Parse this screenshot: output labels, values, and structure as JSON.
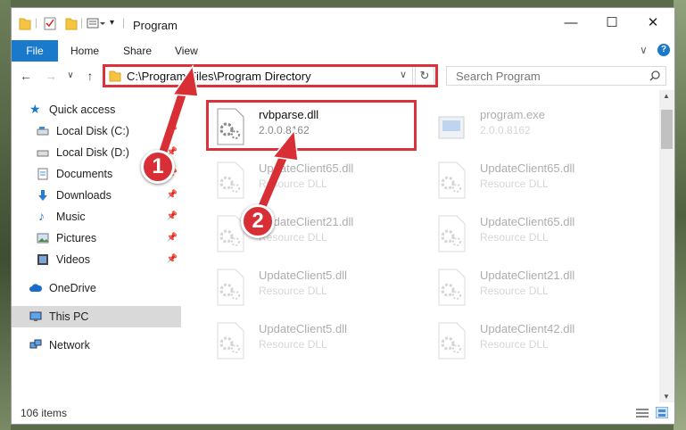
{
  "window": {
    "title": "Program",
    "tabs": [
      "File",
      "Home",
      "Share",
      "View"
    ],
    "address": "C:\\Program Files\\Program Directory",
    "search_placeholder": "Search Program",
    "minimize": "—",
    "maximize": "☐",
    "close": "✕"
  },
  "sidebar": {
    "items": [
      {
        "label": "Quick access",
        "icon": "star-icon"
      },
      {
        "label": "Local Disk (C:)",
        "icon": "drive-icon"
      },
      {
        "label": "Local Disk (D:)",
        "icon": "drive-icon"
      },
      {
        "label": "Documents",
        "icon": "documents-icon"
      },
      {
        "label": "Downloads",
        "icon": "download-icon"
      },
      {
        "label": "Music",
        "icon": "music-icon"
      },
      {
        "label": "Pictures",
        "icon": "pictures-icon"
      },
      {
        "label": "Videos",
        "icon": "videos-icon"
      },
      {
        "label": "OneDrive",
        "icon": "cloud-icon"
      },
      {
        "label": "This PC",
        "icon": "computer-icon"
      },
      {
        "label": "Network",
        "icon": "network-icon"
      }
    ]
  },
  "files": [
    {
      "name": "rvbparse.dll",
      "sub": "2.0.0.8162"
    },
    {
      "name": "program.exe",
      "sub": "2.0.0.8162"
    },
    {
      "name": "UpdateClient65.dll",
      "sub": "Resource DLL"
    },
    {
      "name": "UpdateClient65.dll",
      "sub": "Resource DLL"
    },
    {
      "name": "UpdateClient21.dll",
      "sub": "Resource DLL"
    },
    {
      "name": "UpdateClient65.dll",
      "sub": "Resource DLL"
    },
    {
      "name": "UpdateClient5.dll",
      "sub": "Resource DLL"
    },
    {
      "name": "UpdateClient21.dll",
      "sub": "Resource DLL"
    },
    {
      "name": "UpdateClient5.dll",
      "sub": "Resource DLL"
    },
    {
      "name": "UpdateClient42.dll",
      "sub": "Resource DLL"
    }
  ],
  "status": {
    "count": "106 items"
  },
  "annotations": {
    "step1": "1",
    "step2": "2"
  },
  "colors": {
    "accent": "#1979ca",
    "highlight": "#d9323a",
    "selected": "#d9d9d9"
  }
}
